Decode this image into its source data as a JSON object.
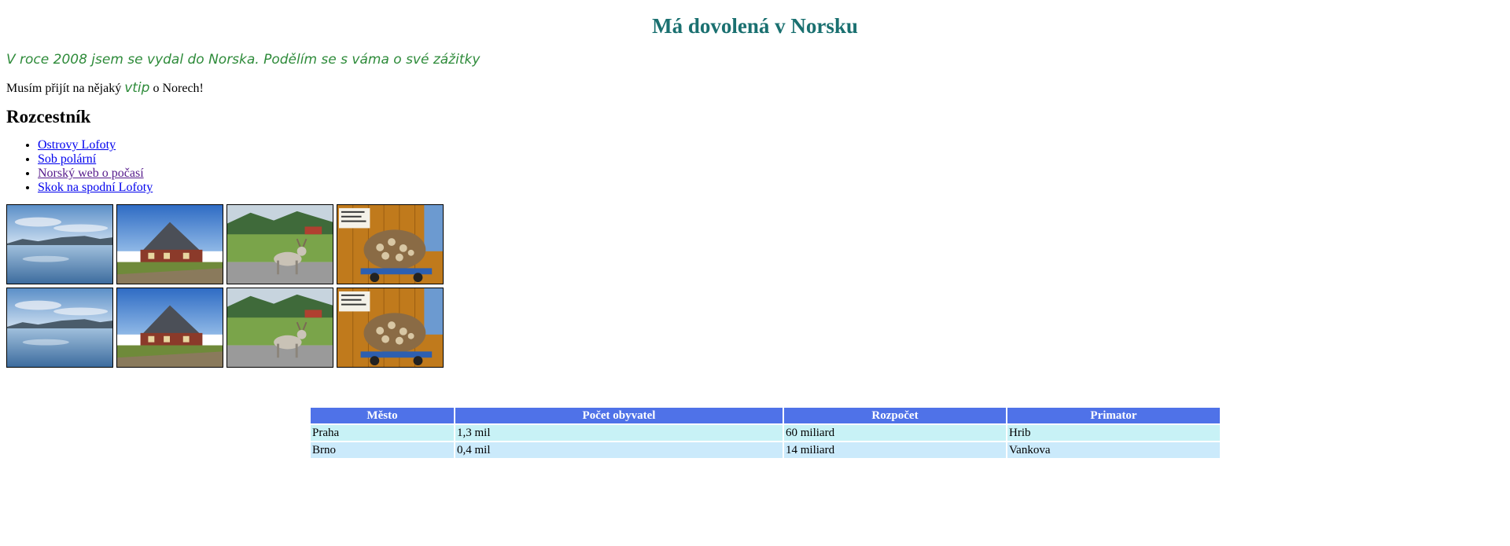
{
  "page": {
    "title": "Má dovolená v Norsku",
    "subtitle": "V roce 2008 jsem se vydal do Norska. Podělím se s váma o své zážitky",
    "joke_before": "Musím přijít na nějaký ",
    "joke_word": "vtip",
    "joke_after": " o Norech!"
  },
  "nav": {
    "heading": "Rozcestník",
    "links": [
      {
        "label": "Ostrovy Lofoty",
        "visited": false
      },
      {
        "label": "Sob polární",
        "visited": false
      },
      {
        "label": "Norský web o počasí",
        "visited": true
      },
      {
        "label": "Skok na spodní Lofoty",
        "visited": false
      }
    ]
  },
  "gallery": {
    "rows": [
      [
        "lake-photo",
        "turf-house-photo",
        "reindeer-photo",
        "firewood-cart-photo"
      ],
      [
        "lake-photo",
        "turf-house-photo",
        "reindeer-photo",
        "firewood-cart-photo"
      ]
    ]
  },
  "table": {
    "headers": [
      "Město",
      "Počet obyvatel",
      "Rozpočet",
      "Primator"
    ],
    "rows": [
      [
        "Praha",
        "1,3 mil",
        "60 miliard",
        "Hrib"
      ],
      [
        "Brno",
        "0,4 mil",
        "14 miliard",
        "Vankova"
      ]
    ],
    "header_color": "#4f72e8",
    "row_colors": [
      "#c8f2f6",
      "#cbeafb"
    ]
  },
  "colors": {
    "title": "#1a7070",
    "subtitle": "#2e8b3a",
    "link": "#0000ee",
    "visited_link": "#551a8b"
  }
}
